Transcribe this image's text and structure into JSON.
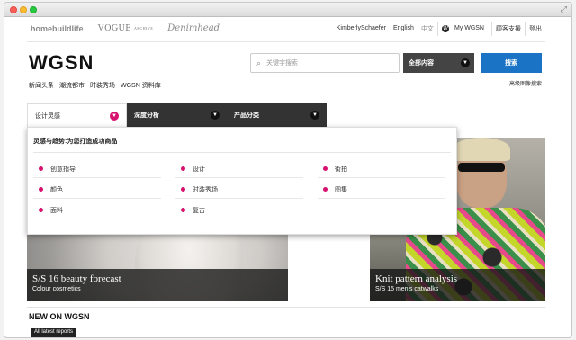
{
  "browser": {
    "resize_icon": "expand-icon"
  },
  "topbar": {
    "brands": [
      "homebuildlife",
      "VOGUE",
      "ARCHIVE",
      "Denimhead"
    ],
    "user": "KimberlySchaefer",
    "lang_en": "English",
    "lang_zh": "中文",
    "my_wgsn_icon": "W",
    "my_wgsn": "My WGSN",
    "support": "顾客支援",
    "logout": "登出"
  },
  "header": {
    "logo": "WGSN",
    "search_placeholder": "关键字搜索",
    "scope": "全部内容",
    "search_button": "搜索",
    "advanced_search": "高级图像搜索",
    "nav": [
      "新闻头条",
      "潮流都市",
      "时装秀场",
      "WGSN 资料库"
    ]
  },
  "tabs": [
    {
      "label": "设计灵感"
    },
    {
      "label": "深度分析"
    },
    {
      "label": "产品分类"
    }
  ],
  "dropdown": {
    "heading": "灵感与趋势:为您打造成功商品",
    "columns": [
      [
        "创意指导",
        "颜色",
        "面料"
      ],
      [
        "设计",
        "时装秀场",
        "复古"
      ],
      [
        "街拍",
        "图集"
      ]
    ]
  },
  "hero": {
    "left": {
      "title": "S/S 16 beauty forecast",
      "subtitle": "Colour cosmetics"
    },
    "right": {
      "title": "Knit pattern analysis",
      "subtitle": "S/S 15 men's catwalks"
    }
  },
  "section": {
    "title": "NEW ON WGSN",
    "button": "All latest reports"
  },
  "colors": {
    "accent_pink": "#d6126e",
    "search_blue": "#1a73c4",
    "dark_tab": "#333333"
  }
}
